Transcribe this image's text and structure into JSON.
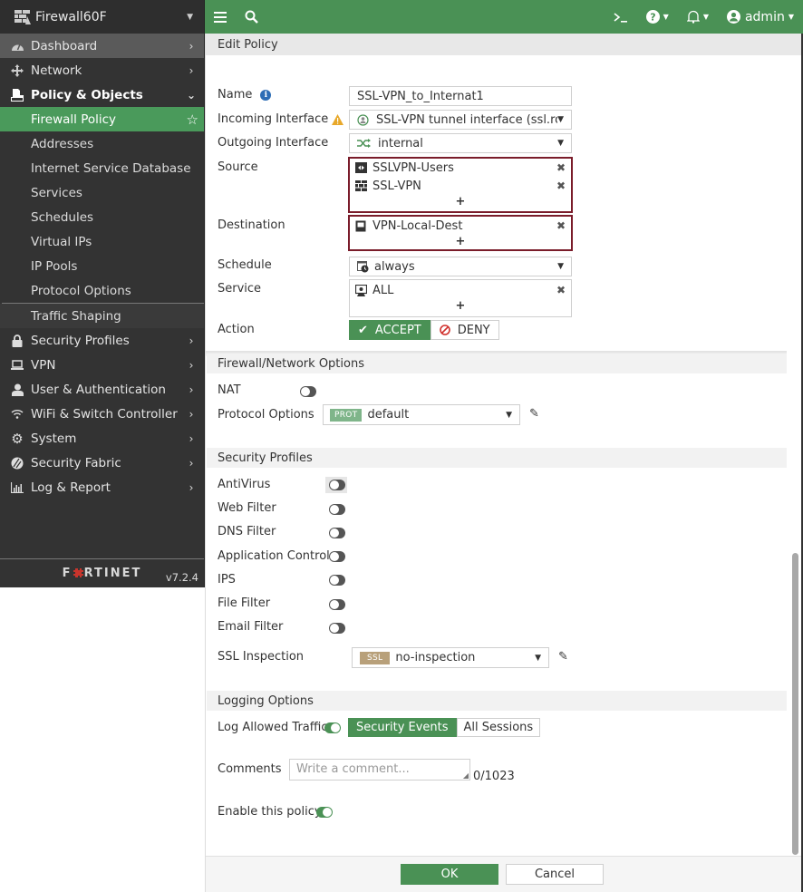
{
  "sidebar": {
    "device_name": "Firewall60F",
    "items": [
      {
        "label": "Dashboard",
        "icon": "dashboard-icon"
      },
      {
        "label": "Network",
        "icon": "network-move-icon"
      },
      {
        "label": "Policy & Objects",
        "icon": "policy-objects-icon"
      }
    ],
    "sub_items": [
      {
        "label": "Firewall Policy",
        "active": true
      },
      {
        "label": "Addresses"
      },
      {
        "label": "Internet Service Database"
      },
      {
        "label": "Services"
      },
      {
        "label": "Schedules"
      },
      {
        "label": "Virtual IPs"
      },
      {
        "label": "IP Pools"
      },
      {
        "label": "Protocol Options"
      },
      {
        "label": "Traffic Shaping"
      }
    ],
    "items_after": [
      {
        "label": "Security Profiles",
        "icon": "lock-icon"
      },
      {
        "label": "VPN",
        "icon": "laptop-icon"
      },
      {
        "label": "User & Authentication",
        "icon": "user-icon"
      },
      {
        "label": "WiFi & Switch Controller",
        "icon": "wifi-icon"
      },
      {
        "label": "System",
        "icon": "gear-icon"
      },
      {
        "label": "Security Fabric",
        "icon": "security-fabric-icon"
      },
      {
        "label": "Log & Report",
        "icon": "bar-chart-icon"
      }
    ],
    "brand": "FORTINET",
    "version": "v7.2.4"
  },
  "topbar": {
    "user": "admin"
  },
  "page": {
    "title": "Edit Policy"
  },
  "form": {
    "name_label": "Name",
    "name_value": "SSL-VPN_to_Internat1",
    "incoming_label": "Incoming Interface",
    "incoming_value": "SSL-VPN tunnel interface (ssl.roo",
    "outgoing_label": "Outgoing Interface",
    "outgoing_value": "internal",
    "source_label": "Source",
    "source_entries": [
      "SSLVPN-Users",
      "SSL-VPN"
    ],
    "destination_label": "Destination",
    "destination_entries": [
      "VPN-Local-Dest"
    ],
    "schedule_label": "Schedule",
    "schedule_value": "always",
    "service_label": "Service",
    "service_entries": [
      "ALL"
    ],
    "add_symbol": "+",
    "remove_symbol": "✖",
    "action_label": "Action",
    "action_accept": "ACCEPT",
    "action_deny": "DENY",
    "action_selected": "ACCEPT"
  },
  "firewall_options": {
    "section_title": "Firewall/Network Options",
    "nat_label": "NAT",
    "nat_enabled": false,
    "protocol_options_label": "Protocol Options",
    "protocol_badge": "PROT",
    "protocol_value": "default"
  },
  "security_profiles": {
    "section_title": "Security Profiles",
    "profiles": [
      {
        "label": "AntiVirus",
        "enabled": false
      },
      {
        "label": "Web Filter",
        "enabled": false
      },
      {
        "label": "DNS Filter",
        "enabled": false
      },
      {
        "label": "Application Control",
        "enabled": false
      },
      {
        "label": "IPS",
        "enabled": false
      },
      {
        "label": "File Filter",
        "enabled": false
      },
      {
        "label": "Email Filter",
        "enabled": false
      }
    ],
    "ssl_label": "SSL Inspection",
    "ssl_badge": "SSL",
    "ssl_value": "no-inspection"
  },
  "logging": {
    "section_title": "Logging Options",
    "log_allowed_label": "Log Allowed Traffic",
    "log_allowed_enabled": true,
    "opt_security_events": "Security Events",
    "opt_all_sessions": "All Sessions",
    "selected": "Security Events"
  },
  "comments": {
    "label": "Comments",
    "placeholder": "Write a comment...",
    "counter": "0/1023"
  },
  "enable_policy": {
    "label": "Enable this policy",
    "enabled": true
  },
  "buttons": {
    "ok": "OK",
    "cancel": "Cancel"
  },
  "colors": {
    "accent_green": "#4a9155",
    "sidebar_bg": "#333333",
    "highlight_border": "#7a1c2a",
    "prot_badge": "#7fb58a",
    "ssl_badge": "#b8a07a"
  }
}
